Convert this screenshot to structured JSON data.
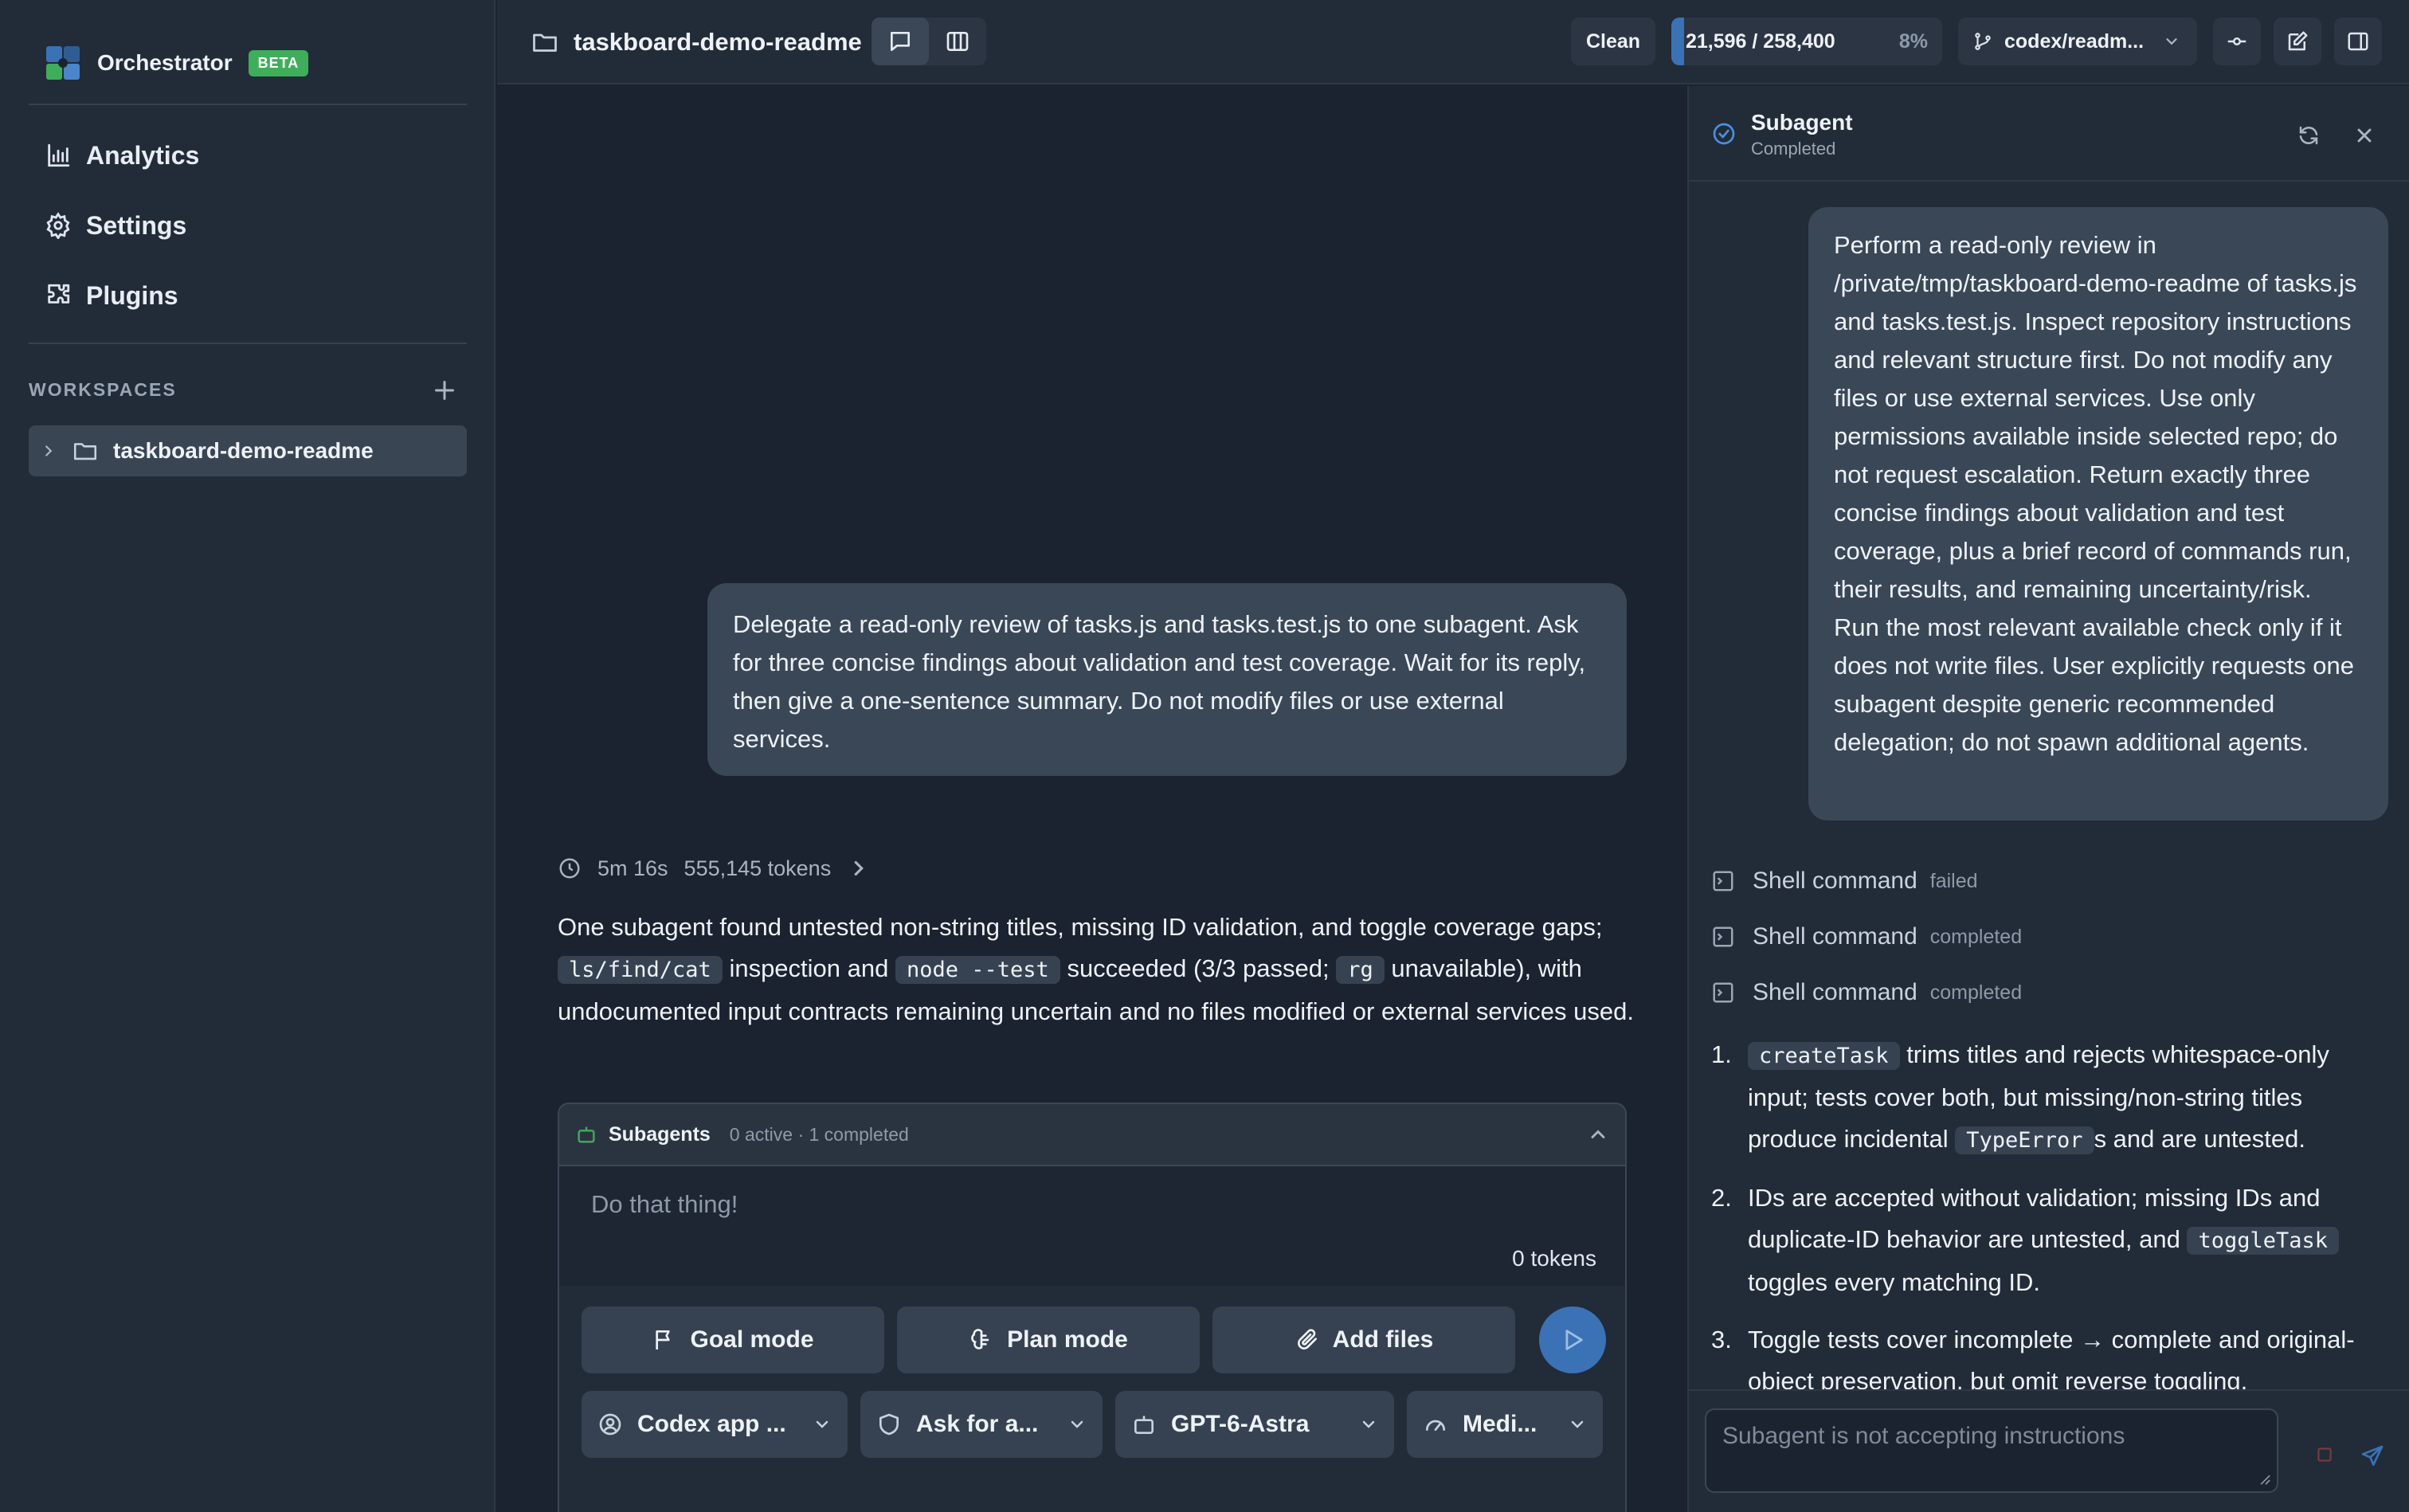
{
  "app": {
    "name": "Orchestrator",
    "badge": "BETA"
  },
  "sidebar": {
    "nav": [
      {
        "label": "Analytics",
        "icon": "chart-bar-icon"
      },
      {
        "label": "Settings",
        "icon": "gear-icon"
      },
      {
        "label": "Plugins",
        "icon": "puzzle-icon"
      }
    ],
    "workspaces_label": "WORKSPACES",
    "workspace": {
      "label": "taskboard-demo-readme"
    }
  },
  "topbar": {
    "title": "taskboard-demo-readme",
    "status": "Clean",
    "context_tokens": "21,596 / 258,400",
    "context_percent": "8%",
    "context_fraction": 0.08,
    "branch": "codex/readm..."
  },
  "chat": {
    "user_message": "Delegate a read-only review of tasks.js and tasks.test.js to one subagent. Ask for three concise findings about validation and test coverage. Wait for its reply, then give a one-sentence summary. Do not modify files or use external services.",
    "meta": {
      "duration": "5m 16s",
      "tokens": "555,145 tokens"
    },
    "summary": {
      "p1": "One subagent found untested non-string titles, missing ID validation, and toggle coverage gaps;",
      "c1": "ls/find/cat",
      "p2": "inspection and",
      "c2": "node --test",
      "p3": "succeeded (3/3 passed;",
      "c3": "rg",
      "p4": "unavailable), with undocumented input contracts remaining uncertain and no files modified or external services used."
    }
  },
  "composer": {
    "subagents_title": "Subagents",
    "subagents_status": "0 active · 1 completed",
    "placeholder": "Do that thing!",
    "token_count": "0 tokens",
    "buttons": {
      "goal": "Goal mode",
      "plan": "Plan mode",
      "files": "Add files"
    },
    "selects": {
      "app": "Codex app ...",
      "approval": "Ask for a...",
      "model": "GPT-6-Astra",
      "effort": "Medi..."
    }
  },
  "panel": {
    "title": "Subagent",
    "status": "Completed",
    "prompt": "Perform a read-only review in /private/tmp/taskboard-demo-readme of tasks.js and tasks.test.js. Inspect repository instructions and relevant structure first. Do not modify any files or use external services. Use only permissions available inside selected repo; do not request escalation. Return exactly three concise findings about validation and test coverage, plus a brief record of commands run, their results, and remaining uncertainty/risk. Run the most relevant available check only if it does not write files. User explicitly requests one subagent despite generic recommended delegation; do not spawn additional agents.",
    "shell_commands": [
      {
        "label": "Shell command",
        "status": "failed"
      },
      {
        "label": "Shell command",
        "status": "completed"
      },
      {
        "label": "Shell command",
        "status": "completed"
      }
    ],
    "findings": {
      "f1": {
        "num": "1.",
        "c1": "createTask",
        "t1": "trims titles and rejects whitespace-only input; tests cover both, but missing/non-string titles produce incidental",
        "c2": "TypeError",
        "t2": "s and are untested."
      },
      "f2": {
        "num": "2.",
        "t1": "IDs are accepted without validation; missing IDs and duplicate-ID behavior are untested, and",
        "c1": "toggleTask",
        "t2": "toggles every matching ID."
      },
      "f3": {
        "num": "3.",
        "t1": "Toggle tests cover incomplete → complete and original-object preservation, but omit reverse toggling,"
      }
    },
    "input_placeholder": "Subagent is not accepting instructions"
  },
  "colors": {
    "accent": "#3a72b5",
    "beta": "#3fae5a",
    "background": "#1b2230",
    "surface": "#222b38"
  }
}
